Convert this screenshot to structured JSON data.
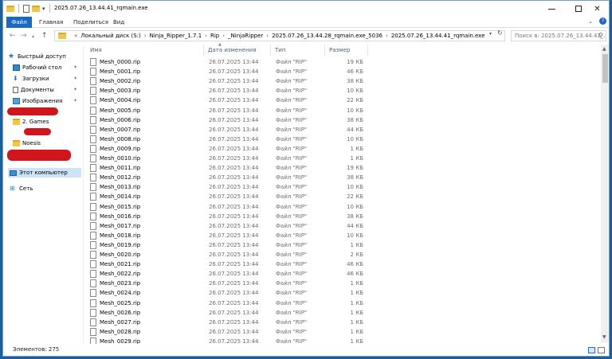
{
  "window": {
    "title": "2025.07.26_13.44.41_rqmain.exe"
  },
  "ribbon": {
    "tabs": [
      "Файл",
      "Главная",
      "Поделиться",
      "Вид"
    ]
  },
  "address": {
    "crumbs": [
      "Локальный диск (S:)",
      "Ninja_Ripper_1.7.1",
      "Rip",
      "_NinjaRipper",
      "2025.07.26_13.44.28_rqmain.exe_5036",
      "2025.07.26_13.44.41_rqmain.exe"
    ]
  },
  "search": {
    "placeholder": "Поиск в: 2025.07.26_13.44.41_..."
  },
  "navpane": {
    "quick_access": "Быстрый доступ",
    "desktop": "Рабочий стол",
    "downloads": "Загрузки",
    "documents": "Документы",
    "images": "Изображения",
    "games": "2. Games",
    "noesis": "Noesis",
    "this_pc": "Этот компьютер",
    "network": "Сеть"
  },
  "columns": {
    "name": "Имя",
    "date": "Дата изменения",
    "type": "Тип",
    "size": "Размер"
  },
  "files": [
    {
      "name": "Mesh_0000.rip",
      "date": "26.07.2025 13:44",
      "type": "Файл \"RIP\"",
      "size": "19 КБ"
    },
    {
      "name": "Mesh_0001.rip",
      "date": "26.07.2025 13:44",
      "type": "Файл \"RIP\"",
      "size": "46 КБ"
    },
    {
      "name": "Mesh_0002.rip",
      "date": "26.07.2025 13:44",
      "type": "Файл \"RIP\"",
      "size": "38 КБ"
    },
    {
      "name": "Mesh_0003.rip",
      "date": "26.07.2025 13:44",
      "type": "Файл \"RIP\"",
      "size": "10 КБ"
    },
    {
      "name": "Mesh_0004.rip",
      "date": "26.07.2025 13:44",
      "type": "Файл \"RIP\"",
      "size": "22 КБ"
    },
    {
      "name": "Mesh_0005.rip",
      "date": "26.07.2025 13:44",
      "type": "Файл \"RIP\"",
      "size": "10 КБ"
    },
    {
      "name": "Mesh_0006.rip",
      "date": "26.07.2025 13:44",
      "type": "Файл \"RIP\"",
      "size": "38 КБ"
    },
    {
      "name": "Mesh_0007.rip",
      "date": "26.07.2025 13:44",
      "type": "Файл \"RIP\"",
      "size": "44 КБ"
    },
    {
      "name": "Mesh_0008.rip",
      "date": "26.07.2025 13:44",
      "type": "Файл \"RIP\"",
      "size": "10 КБ"
    },
    {
      "name": "Mesh_0009.rip",
      "date": "26.07.2025 13:44",
      "type": "Файл \"RIP\"",
      "size": "1 КБ"
    },
    {
      "name": "Mesh_0010.rip",
      "date": "26.07.2025 13:44",
      "type": "Файл \"RIP\"",
      "size": "1 КБ"
    },
    {
      "name": "Mesh_0011.rip",
      "date": "26.07.2025 13:44",
      "type": "Файл \"RIP\"",
      "size": "19 КБ"
    },
    {
      "name": "Mesh_0012.rip",
      "date": "26.07.2025 13:44",
      "type": "Файл \"RIP\"",
      "size": "38 КБ"
    },
    {
      "name": "Mesh_0013.rip",
      "date": "26.07.2025 13:44",
      "type": "Файл \"RIP\"",
      "size": "10 КБ"
    },
    {
      "name": "Mesh_0014.rip",
      "date": "26.07.2025 13:44",
      "type": "Файл \"RIP\"",
      "size": "22 КБ"
    },
    {
      "name": "Mesh_0015.rip",
      "date": "26.07.2025 13:44",
      "type": "Файл \"RIP\"",
      "size": "10 КБ"
    },
    {
      "name": "Mesh_0016.rip",
      "date": "26.07.2025 13:44",
      "type": "Файл \"RIP\"",
      "size": "38 КБ"
    },
    {
      "name": "Mesh_0017.rip",
      "date": "26.07.2025 13:44",
      "type": "Файл \"RIP\"",
      "size": "44 КБ"
    },
    {
      "name": "Mesh_0018.rip",
      "date": "26.07.2025 13:44",
      "type": "Файл \"RIP\"",
      "size": "10 КБ"
    },
    {
      "name": "Mesh_0019.rip",
      "date": "26.07.2025 13:44",
      "type": "Файл \"RIP\"",
      "size": "1 КБ"
    },
    {
      "name": "Mesh_0020.rip",
      "date": "26.07.2025 13:44",
      "type": "Файл \"RIP\"",
      "size": "2 КБ"
    },
    {
      "name": "Mesh_0021.rip",
      "date": "26.07.2025 13:44",
      "type": "Файл \"RIP\"",
      "size": "46 КБ"
    },
    {
      "name": "Mesh_0022.rip",
      "date": "26.07.2025 13:44",
      "type": "Файл \"RIP\"",
      "size": "46 КБ"
    },
    {
      "name": "Mesh_0023.rip",
      "date": "26.07.2025 13:44",
      "type": "Файл \"RIP\"",
      "size": "1 КБ"
    },
    {
      "name": "Mesh_0024.rip",
      "date": "26.07.2025 13:44",
      "type": "Файл \"RIP\"",
      "size": "1 КБ"
    },
    {
      "name": "Mesh_0025.rip",
      "date": "26.07.2025 13:44",
      "type": "Файл \"RIP\"",
      "size": "1 КБ"
    },
    {
      "name": "Mesh_0026.rip",
      "date": "26.07.2025 13:44",
      "type": "Файл \"RIP\"",
      "size": "1 КБ"
    },
    {
      "name": "Mesh_0027.rip",
      "date": "26.07.2025 13:44",
      "type": "Файл \"RIP\"",
      "size": "1 КБ"
    },
    {
      "name": "Mesh_0028.rip",
      "date": "26.07.2025 13:44",
      "type": "Файл \"RIP\"",
      "size": "1 КБ"
    },
    {
      "name": "Mesh_0029.rip",
      "date": "26.07.2025 13:44",
      "type": "Файл \"RIP\"",
      "size": "1 КБ"
    }
  ],
  "status": {
    "items": "Элементов: 275"
  },
  "colors": {
    "accent": "#1968c4",
    "selection": "#cce4f7",
    "redaction": "#d0151b"
  }
}
